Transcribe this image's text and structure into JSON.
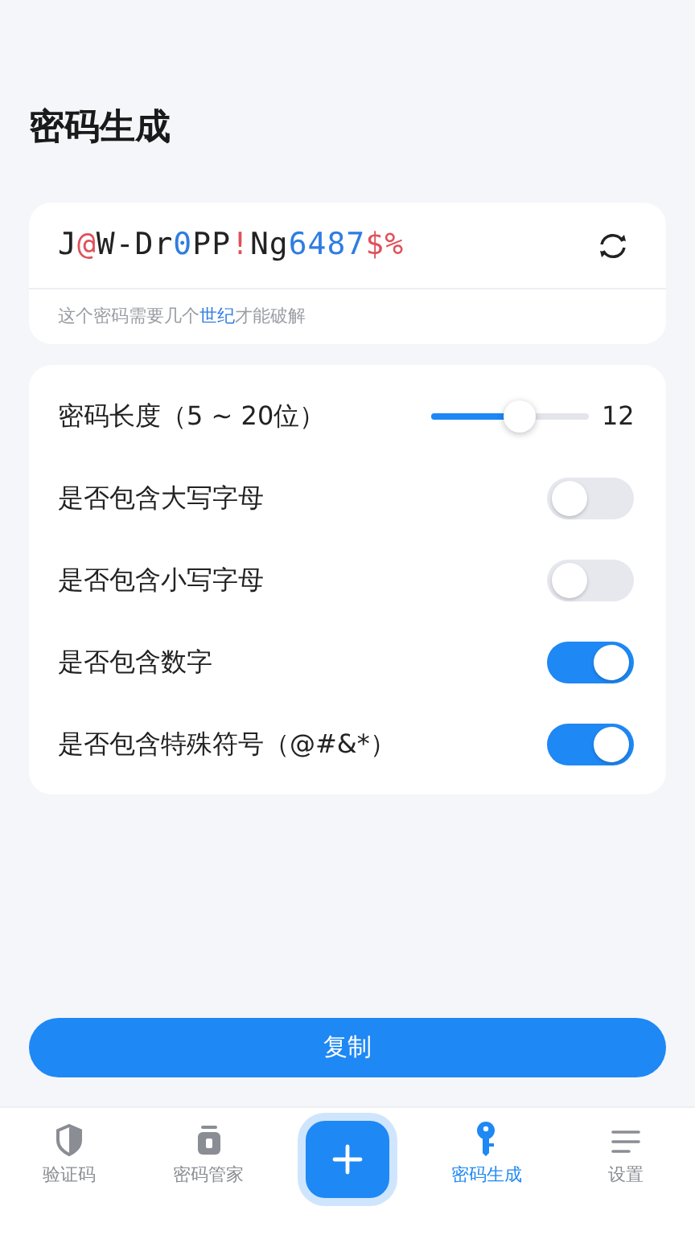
{
  "title": "密码生成",
  "password": {
    "segments": [
      {
        "text": "J",
        "kind": "letter"
      },
      {
        "text": "@",
        "kind": "symbol"
      },
      {
        "text": "W-Dr",
        "kind": "letter"
      },
      {
        "text": "0",
        "kind": "digit"
      },
      {
        "text": "PP",
        "kind": "letter"
      },
      {
        "text": "!",
        "kind": "symbol"
      },
      {
        "text": "Ng",
        "kind": "letter"
      },
      {
        "text": "6487",
        "kind": "digit"
      },
      {
        "text": "$%",
        "kind": "symbol"
      }
    ],
    "strength": [
      {
        "text": "这个密码需要几个",
        "highlight": false
      },
      {
        "text": "世纪",
        "highlight": true
      },
      {
        "text": "才能破解",
        "highlight": false
      }
    ]
  },
  "options": [
    {
      "kind": "slider",
      "label": "密码长度（5 ~ 20位）",
      "level": 0.56,
      "reading": "12"
    },
    {
      "kind": "switch",
      "label": "是否包含大写字母",
      "on": false
    },
    {
      "kind": "switch",
      "label": "是否包含小写字母",
      "on": false
    },
    {
      "kind": "switch",
      "label": "是否包含数字",
      "on": true
    },
    {
      "kind": "switch",
      "label": "是否包含特殊符号（@#&*）",
      "on": true
    }
  ],
  "copy_button": "复制",
  "tab_bar": [
    {
      "kind": "shield",
      "label": "验证码",
      "selected": false
    },
    {
      "kind": "lock",
      "label": "密码管家",
      "selected": false
    },
    {
      "kind": "plus"
    },
    {
      "kind": "key",
      "label": "密码生成",
      "selected": true
    },
    {
      "kind": "menu",
      "label": "设置",
      "selected": false
    }
  ]
}
